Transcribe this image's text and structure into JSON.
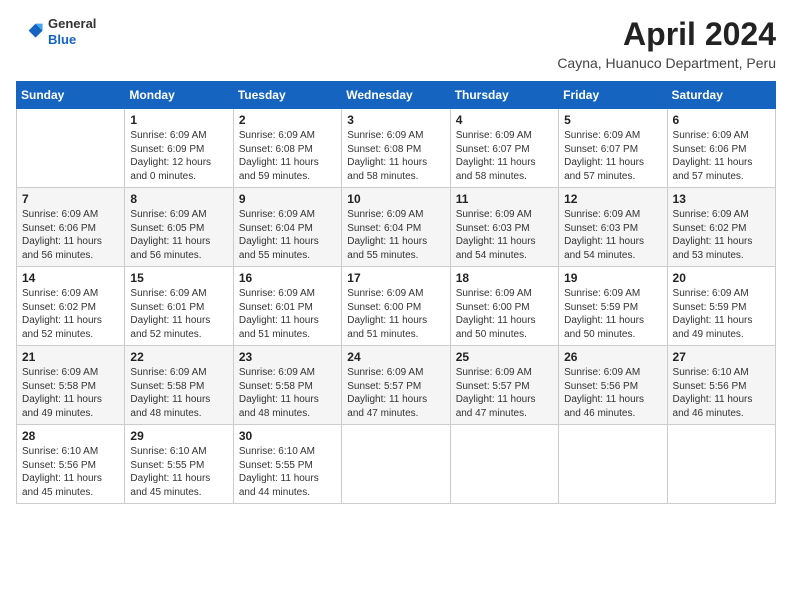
{
  "header": {
    "logo": {
      "line1": "General",
      "line2": "Blue"
    },
    "title": "April 2024",
    "location": "Cayna, Huanuco Department, Peru"
  },
  "calendar": {
    "columns": [
      "Sunday",
      "Monday",
      "Tuesday",
      "Wednesday",
      "Thursday",
      "Friday",
      "Saturday"
    ],
    "weeks": [
      [
        {
          "day": "",
          "info": ""
        },
        {
          "day": "1",
          "info": "Sunrise: 6:09 AM\nSunset: 6:09 PM\nDaylight: 12 hours\nand 0 minutes."
        },
        {
          "day": "2",
          "info": "Sunrise: 6:09 AM\nSunset: 6:08 PM\nDaylight: 11 hours\nand 59 minutes."
        },
        {
          "day": "3",
          "info": "Sunrise: 6:09 AM\nSunset: 6:08 PM\nDaylight: 11 hours\nand 58 minutes."
        },
        {
          "day": "4",
          "info": "Sunrise: 6:09 AM\nSunset: 6:07 PM\nDaylight: 11 hours\nand 58 minutes."
        },
        {
          "day": "5",
          "info": "Sunrise: 6:09 AM\nSunset: 6:07 PM\nDaylight: 11 hours\nand 57 minutes."
        },
        {
          "day": "6",
          "info": "Sunrise: 6:09 AM\nSunset: 6:06 PM\nDaylight: 11 hours\nand 57 minutes."
        }
      ],
      [
        {
          "day": "7",
          "info": "Sunrise: 6:09 AM\nSunset: 6:06 PM\nDaylight: 11 hours\nand 56 minutes."
        },
        {
          "day": "8",
          "info": "Sunrise: 6:09 AM\nSunset: 6:05 PM\nDaylight: 11 hours\nand 56 minutes."
        },
        {
          "day": "9",
          "info": "Sunrise: 6:09 AM\nSunset: 6:04 PM\nDaylight: 11 hours\nand 55 minutes."
        },
        {
          "day": "10",
          "info": "Sunrise: 6:09 AM\nSunset: 6:04 PM\nDaylight: 11 hours\nand 55 minutes."
        },
        {
          "day": "11",
          "info": "Sunrise: 6:09 AM\nSunset: 6:03 PM\nDaylight: 11 hours\nand 54 minutes."
        },
        {
          "day": "12",
          "info": "Sunrise: 6:09 AM\nSunset: 6:03 PM\nDaylight: 11 hours\nand 54 minutes."
        },
        {
          "day": "13",
          "info": "Sunrise: 6:09 AM\nSunset: 6:02 PM\nDaylight: 11 hours\nand 53 minutes."
        }
      ],
      [
        {
          "day": "14",
          "info": "Sunrise: 6:09 AM\nSunset: 6:02 PM\nDaylight: 11 hours\nand 52 minutes."
        },
        {
          "day": "15",
          "info": "Sunrise: 6:09 AM\nSunset: 6:01 PM\nDaylight: 11 hours\nand 52 minutes."
        },
        {
          "day": "16",
          "info": "Sunrise: 6:09 AM\nSunset: 6:01 PM\nDaylight: 11 hours\nand 51 minutes."
        },
        {
          "day": "17",
          "info": "Sunrise: 6:09 AM\nSunset: 6:00 PM\nDaylight: 11 hours\nand 51 minutes."
        },
        {
          "day": "18",
          "info": "Sunrise: 6:09 AM\nSunset: 6:00 PM\nDaylight: 11 hours\nand 50 minutes."
        },
        {
          "day": "19",
          "info": "Sunrise: 6:09 AM\nSunset: 5:59 PM\nDaylight: 11 hours\nand 50 minutes."
        },
        {
          "day": "20",
          "info": "Sunrise: 6:09 AM\nSunset: 5:59 PM\nDaylight: 11 hours\nand 49 minutes."
        }
      ],
      [
        {
          "day": "21",
          "info": "Sunrise: 6:09 AM\nSunset: 5:58 PM\nDaylight: 11 hours\nand 49 minutes."
        },
        {
          "day": "22",
          "info": "Sunrise: 6:09 AM\nSunset: 5:58 PM\nDaylight: 11 hours\nand 48 minutes."
        },
        {
          "day": "23",
          "info": "Sunrise: 6:09 AM\nSunset: 5:58 PM\nDaylight: 11 hours\nand 48 minutes."
        },
        {
          "day": "24",
          "info": "Sunrise: 6:09 AM\nSunset: 5:57 PM\nDaylight: 11 hours\nand 47 minutes."
        },
        {
          "day": "25",
          "info": "Sunrise: 6:09 AM\nSunset: 5:57 PM\nDaylight: 11 hours\nand 47 minutes."
        },
        {
          "day": "26",
          "info": "Sunrise: 6:09 AM\nSunset: 5:56 PM\nDaylight: 11 hours\nand 46 minutes."
        },
        {
          "day": "27",
          "info": "Sunrise: 6:10 AM\nSunset: 5:56 PM\nDaylight: 11 hours\nand 46 minutes."
        }
      ],
      [
        {
          "day": "28",
          "info": "Sunrise: 6:10 AM\nSunset: 5:56 PM\nDaylight: 11 hours\nand 45 minutes."
        },
        {
          "day": "29",
          "info": "Sunrise: 6:10 AM\nSunset: 5:55 PM\nDaylight: 11 hours\nand 45 minutes."
        },
        {
          "day": "30",
          "info": "Sunrise: 6:10 AM\nSunset: 5:55 PM\nDaylight: 11 hours\nand 44 minutes."
        },
        {
          "day": "",
          "info": ""
        },
        {
          "day": "",
          "info": ""
        },
        {
          "day": "",
          "info": ""
        },
        {
          "day": "",
          "info": ""
        }
      ]
    ]
  }
}
